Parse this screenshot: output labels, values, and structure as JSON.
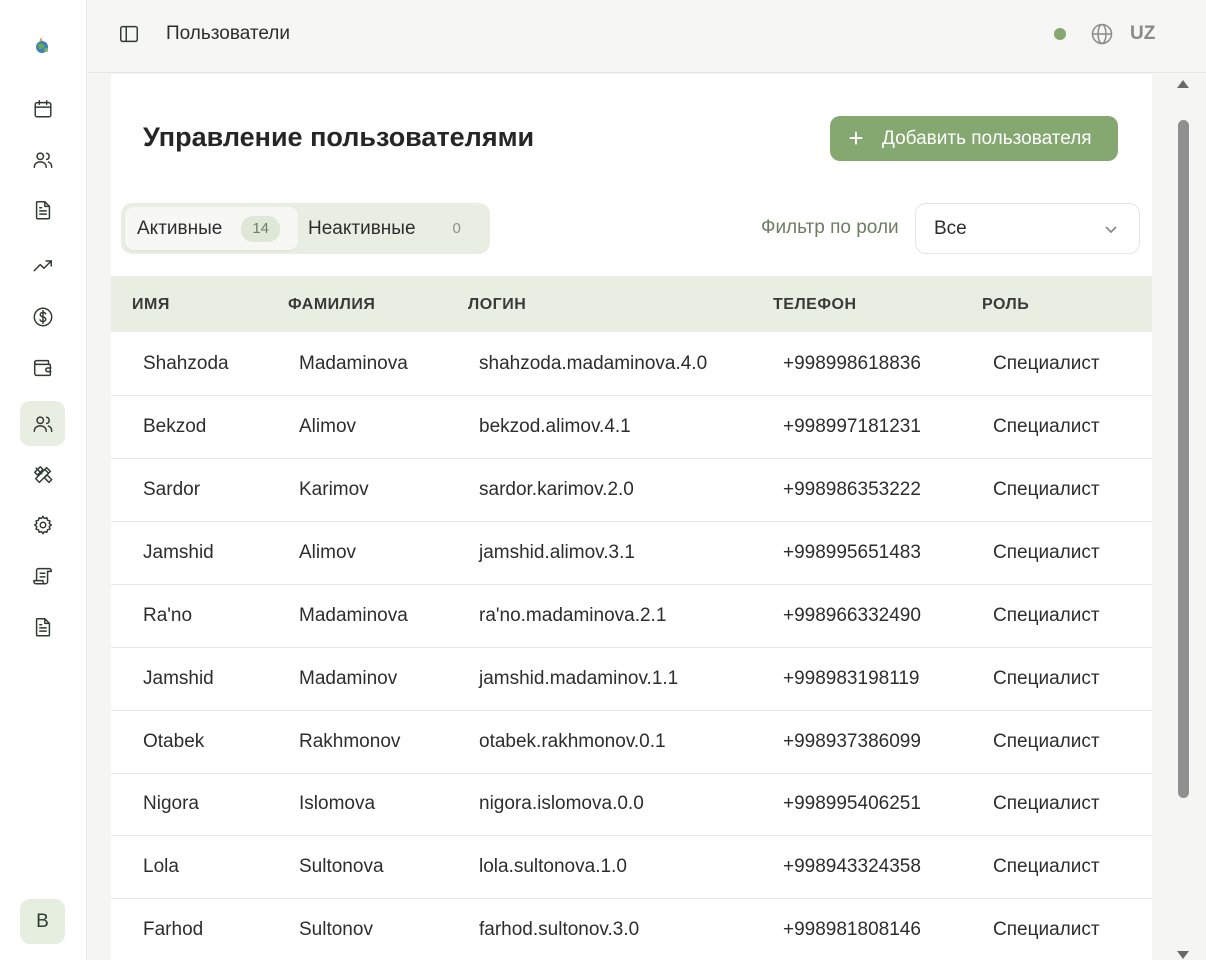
{
  "header": {
    "title": "Пользователи",
    "language": "UZ"
  },
  "sidebar": {
    "items": [
      {
        "icon": "calendar-icon"
      },
      {
        "icon": "users-icon"
      },
      {
        "icon": "document-icon"
      },
      {
        "icon": "trending-up-icon"
      },
      {
        "icon": "dollar-icon"
      },
      {
        "icon": "wallet-icon"
      },
      {
        "icon": "users-icon",
        "active": true
      },
      {
        "icon": "tools-icon"
      },
      {
        "icon": "settings-icon"
      },
      {
        "icon": "scroll-icon"
      },
      {
        "icon": "document-icon"
      }
    ],
    "avatar": "B"
  },
  "main": {
    "heading": "Управление пользователями",
    "add_button": "Добавить пользователя",
    "tabs": [
      {
        "label": "Активные",
        "count": "14"
      },
      {
        "label": "Неактивные",
        "count": "0"
      }
    ],
    "filter": {
      "label": "Фильтр по роли",
      "value": "Все"
    },
    "table": {
      "columns": [
        "ИМЯ",
        "ФАМИЛИЯ",
        "ЛОГИН",
        "ТЕЛЕФОН",
        "РОЛЬ"
      ],
      "rows": [
        [
          "Shahzoda",
          "Madaminova",
          "shahzoda.madaminova.4.0",
          "+998998618836",
          "Специалист"
        ],
        [
          "Bekzod",
          "Alimov",
          "bekzod.alimov.4.1",
          "+998997181231",
          "Специалист"
        ],
        [
          "Sardor",
          "Karimov",
          "sardor.karimov.2.0",
          "+998986353222",
          "Специалист"
        ],
        [
          "Jamshid",
          "Alimov",
          "jamshid.alimov.3.1",
          "+998995651483",
          "Специалист"
        ],
        [
          "Ra'no",
          "Madaminova",
          "ra'no.madaminova.2.1",
          "+998966332490",
          "Специалист"
        ],
        [
          "Jamshid",
          "Madaminov",
          "jamshid.madaminov.1.1",
          "+998983198119",
          "Специалист"
        ],
        [
          "Otabek",
          "Rakhmonov",
          "otabek.rakhmonov.0.1",
          "+998937386099",
          "Специалист"
        ],
        [
          "Nigora",
          "Islomova",
          "nigora.islomova.0.0",
          "+998995406251",
          "Специалист"
        ],
        [
          "Lola",
          "Sultonova",
          "lola.sultonova.1.0",
          "+998943324358",
          "Специалист"
        ],
        [
          "Farhod",
          "Sultonov",
          "farhod.sultonov.3.0",
          "+998981808146",
          "Специалист"
        ]
      ]
    }
  },
  "colors": {
    "accent": "#84a870",
    "header_bg": "#e8efe2",
    "active_nav_bg": "#e8efe2"
  }
}
